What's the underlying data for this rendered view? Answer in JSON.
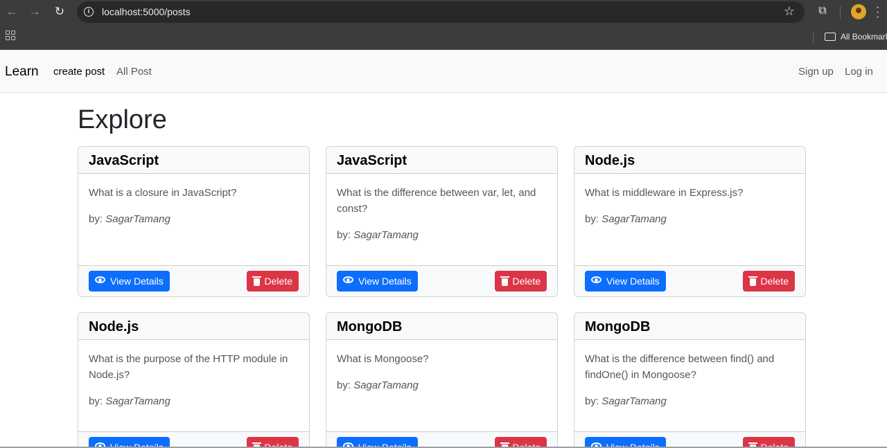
{
  "browser": {
    "url": "localhost:5000/posts",
    "bookmarks_label": "All Bookmarks"
  },
  "navbar": {
    "brand": "Learn",
    "links": [
      "create post",
      "All Post"
    ],
    "auth": [
      "Sign up",
      "Log in"
    ]
  },
  "page": {
    "title": "Explore"
  },
  "buttons": {
    "view": "View Details",
    "delete": "Delete"
  },
  "posts": [
    {
      "category": "JavaScript",
      "question": "What is a closure in JavaScript?",
      "by_label": "by:",
      "author": "SagarTamang"
    },
    {
      "category": "JavaScript",
      "question": "What is the difference between var, let, and const?",
      "by_label": "by:",
      "author": "SagarTamang"
    },
    {
      "category": "Node.js",
      "question": "What is middleware in Express.js?",
      "by_label": "by:",
      "author": "SagarTamang"
    },
    {
      "category": "Node.js",
      "question": "What is the purpose of the HTTP module in Node.js?",
      "by_label": "by:",
      "author": "SagarTamang"
    },
    {
      "category": "MongoDB",
      "question": "What is Mongoose?",
      "by_label": "by:",
      "author": "SagarTamang"
    },
    {
      "category": "MongoDB",
      "question": "What is the difference between find() and findOne() in Mongoose?",
      "by_label": "by:",
      "author": "SagarTamang"
    }
  ],
  "colors": {
    "primary": "#0d6efd",
    "danger": "#dc3545",
    "navbar_bg": "#f8f9fa",
    "chrome_bg": "#3c3c3c"
  }
}
